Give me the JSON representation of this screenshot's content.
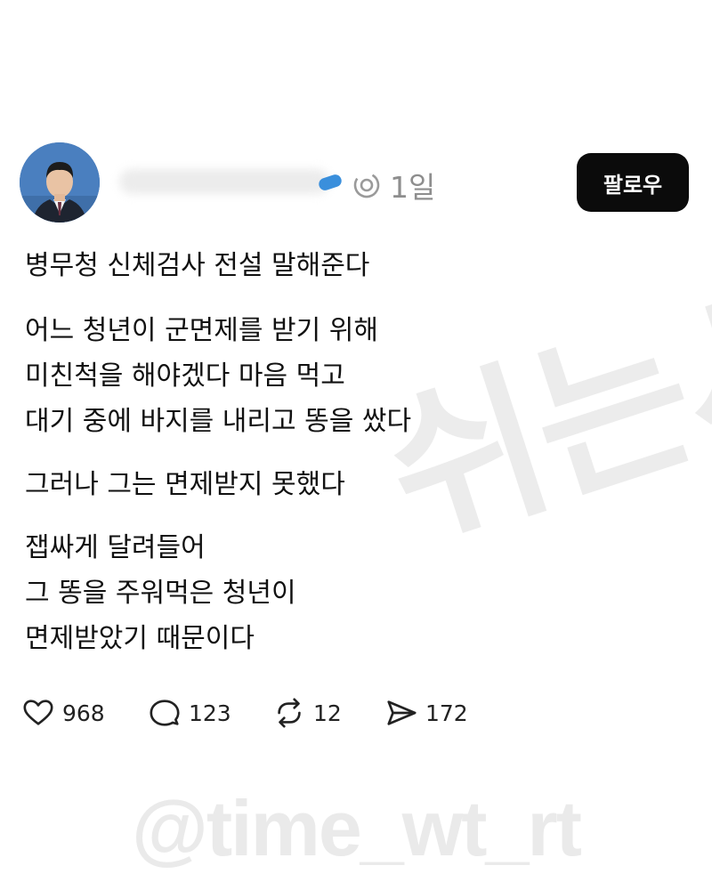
{
  "post": {
    "time": "1일",
    "follow_label": "팔로우",
    "title": "병무청 신체검사 전설 말해준다",
    "paragraphs": [
      [
        "어느 청년이 군면제를 받기 위해",
        "미친척을 해야겠다 마음 먹고",
        "대기 중에 바지를 내리고 똥을 쌌다"
      ],
      [
        "그러나 그는 면제받지 못했다"
      ],
      [
        "잽싸게 달려들어",
        "그 똥을 주워먹은 청년이",
        "면제받았기 때문이다"
      ]
    ]
  },
  "actions": {
    "likes": "968",
    "comments": "123",
    "reposts": "12",
    "shares": "172"
  },
  "icons": {
    "like": "heart-outline-icon",
    "comment": "speech-bubble-icon",
    "repost": "repost-arrows-icon",
    "share": "send-icon"
  },
  "watermark": {
    "diagonal": "쉬는시간",
    "handle": "@time_wt_rt"
  },
  "colors": {
    "follow_button_bg": "#0b0b0b",
    "follow_button_text": "#ffffff",
    "meta_text": "#8e8e8e",
    "watermark": "#ececec"
  }
}
